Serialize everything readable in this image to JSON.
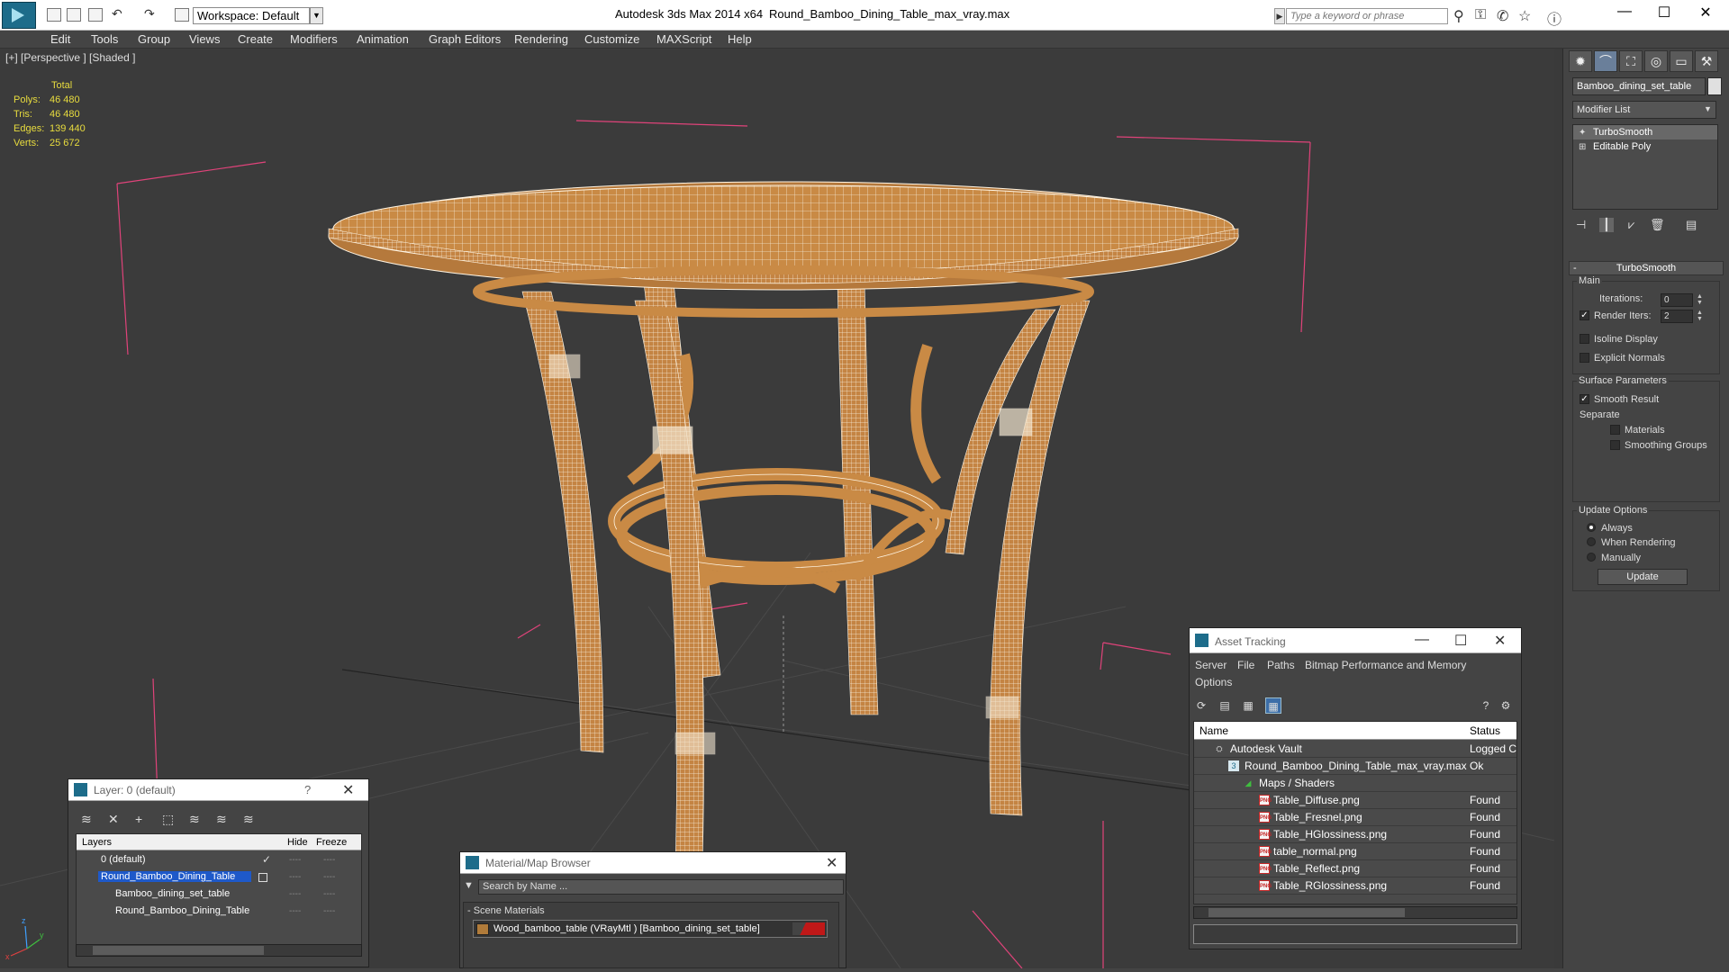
{
  "titlebar": {
    "app_title": "Autodesk 3ds Max  2014 x64",
    "file_name": "Round_Bamboo_Dining_Table_max_vray.max",
    "workspace": "Workspace: Default",
    "keyword_placeholder": "Type a keyword or phrase"
  },
  "menu": [
    "Edit",
    "Tools",
    "Group",
    "Views",
    "Create",
    "Modifiers",
    "Animation",
    "Graph Editors",
    "Rendering",
    "Customize",
    "MAXScript",
    "Help"
  ],
  "viewport": {
    "label": "[+] [Perspective ] [Shaded ]",
    "stats": {
      "header": "Total",
      "rows": [
        {
          "label": "Polys:",
          "value": "46 480"
        },
        {
          "label": "Tris:",
          "value": "46 480"
        },
        {
          "label": "Edges:",
          "value": "139 440"
        },
        {
          "label": "Verts:",
          "value": "25 672"
        }
      ]
    },
    "axis_labels": {
      "x": "x",
      "y": "y",
      "z": "z"
    }
  },
  "command_panel": {
    "object_name": "Bamboo_dining_set_table",
    "modifier_list": "Modifier List",
    "stack": [
      "TurboSmooth",
      "Editable Poly"
    ],
    "rollout_title": "TurboSmooth",
    "main_group": "Main",
    "iterations_label": "Iterations:",
    "iterations_value": "0",
    "render_iters_label": "Render Iters:",
    "render_iters_value": "2",
    "isoline_label": "Isoline Display",
    "explicit_normals_label": "Explicit Normals",
    "surface_group": "Surface Parameters",
    "smooth_result_label": "Smooth Result",
    "separate_label": "Separate",
    "materials_label": "Materials",
    "smoothing_groups_label": "Smoothing Groups",
    "update_group": "Update Options",
    "always_label": "Always",
    "when_rendering_label": "When Rendering",
    "manually_label": "Manually",
    "update_button": "Update"
  },
  "layer_dialog": {
    "title": "Layer: 0 (default)",
    "help": "?",
    "columns": {
      "layers": "Layers",
      "hide": "Hide",
      "freeze": "Freeze"
    },
    "rows": [
      {
        "name": "0 (default)"
      },
      {
        "name": "Round_Bamboo_Dining_Table"
      },
      {
        "name": "Bamboo_dining_set_table"
      },
      {
        "name": "Round_Bamboo_Dining_Table"
      }
    ],
    "dash": "----"
  },
  "material_browser": {
    "title": "Material/Map Browser",
    "search_placeholder": "Search by Name ...",
    "group": "- Scene Materials",
    "item": "Wood_bamboo_table (VRayMtl ) [Bamboo_dining_set_table]"
  },
  "asset_tracking": {
    "title": "Asset Tracking",
    "menu": [
      "Server",
      "File",
      "Paths",
      "Bitmap Performance and Memory",
      "Options"
    ],
    "columns": {
      "name": "Name",
      "status": "Status"
    },
    "rows": [
      {
        "name": "Autodesk Vault",
        "status": "Logged C"
      },
      {
        "name": "Round_Bamboo_Dining_Table_max_vray.max",
        "status": "Ok"
      },
      {
        "name": "Maps / Shaders",
        "status": ""
      },
      {
        "name": "Table_Diffuse.png",
        "status": "Found"
      },
      {
        "name": "Table_Fresnel.png",
        "status": "Found"
      },
      {
        "name": "Table_HGlossiness.png",
        "status": "Found"
      },
      {
        "name": "table_normal.png",
        "status": "Found"
      },
      {
        "name": "Table_Reflect.png",
        "status": "Found"
      },
      {
        "name": "Table_RGlossiness.png",
        "status": "Found"
      }
    ],
    "png_badge": "PNG"
  },
  "colors": {
    "accent_blue": "#1e59c9",
    "stats_yellow": "#e8dc3e",
    "bbox_pink": "#e0437a",
    "bamboo": "#c98a45"
  }
}
